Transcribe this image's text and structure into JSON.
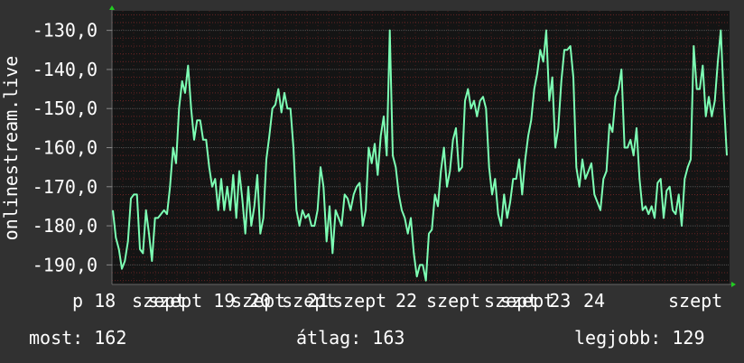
{
  "chart_data": {
    "type": "line",
    "ylabel": "onlinestream.live",
    "ylim": [
      -195,
      -125
    ],
    "yticks": [
      -190,
      -180,
      -170,
      -160,
      -150,
      -140,
      -130
    ],
    "ytick_labels": [
      "-190,0",
      "-180,0",
      "-170,0",
      "-160,0",
      "-150,0",
      "-140,0",
      "-130,0"
    ],
    "x_tick_labels": [
      "p 18",
      "szept",
      "szept 19",
      "szept",
      "20 szept",
      "21",
      "szept",
      "22",
      "szept",
      "szept 23",
      "szept",
      "24",
      "szept"
    ],
    "x_date_range": [
      "szept 18",
      "szept 24"
    ],
    "grid": true,
    "colors": {
      "background": "#313131",
      "plot": "#141414",
      "series": "#7dffb4",
      "grid_major": "#505050",
      "grid_minor": "#8a2a2a",
      "arrow": "#22cc22"
    },
    "series": [
      {
        "values": [
          -176,
          -183,
          -186,
          -191,
          -189,
          -184,
          -173,
          -172,
          -172,
          -186,
          -187,
          -176,
          -182,
          -189,
          -178,
          -178,
          -177,
          -176,
          -177,
          -170,
          -160,
          -164,
          -150,
          -143,
          -146,
          -139,
          -150,
          -158,
          -153,
          -153,
          -158,
          -158,
          -165,
          -170,
          -168,
          -176,
          -168,
          -176,
          -170,
          -176,
          -167,
          -178,
          -166,
          -173,
          -182,
          -170,
          -180,
          -175,
          -167,
          -182,
          -178,
          -163,
          -157,
          -150,
          -149,
          -145,
          -151,
          -146,
          -150,
          -150,
          -160,
          -176,
          -180,
          -176,
          -178,
          -177,
          -180,
          -180,
          -176,
          -165,
          -170,
          -184,
          -175,
          -187,
          -176,
          -178,
          -180,
          -172,
          -173,
          -176,
          -172,
          -170,
          -169,
          -180,
          -176,
          -160,
          -164,
          -159,
          -167,
          -157,
          -152,
          -162,
          -130,
          -162,
          -165,
          -172,
          -176,
          -178,
          -182,
          -178,
          -187,
          -193,
          -190,
          -190,
          -194,
          -182,
          -181,
          -172,
          -175,
          -166,
          -160,
          -170,
          -166,
          -158,
          -155,
          -166,
          -165,
          -148,
          -145,
          -150,
          -148,
          -152,
          -148,
          -147,
          -150,
          -165,
          -172,
          -168,
          -177,
          -180,
          -172,
          -178,
          -174,
          -168,
          -168,
          -163,
          -172,
          -163,
          -157,
          -153,
          -145,
          -141,
          -135,
          -138,
          -130,
          -148,
          -142,
          -160,
          -155,
          -143,
          -135,
          -135,
          -134,
          -142,
          -165,
          -170,
          -163,
          -168,
          -166,
          -164,
          -172,
          -174,
          -176,
          -168,
          -166,
          -154,
          -156,
          -147,
          -145,
          -140,
          -160,
          -160,
          -158,
          -162,
          -155,
          -168,
          -176,
          -175,
          -177,
          -175,
          -178,
          -169,
          -168,
          -178,
          -171,
          -170,
          -176,
          -177,
          -172,
          -180,
          -168,
          -165,
          -163,
          -134,
          -145,
          -145,
          -139,
          -152,
          -147,
          -152,
          -148,
          -138,
          -130,
          -148,
          -162
        ]
      }
    ]
  },
  "stats": {
    "now": "most: 162",
    "avg": "átlag: 163",
    "best": "legjobb: 129"
  }
}
